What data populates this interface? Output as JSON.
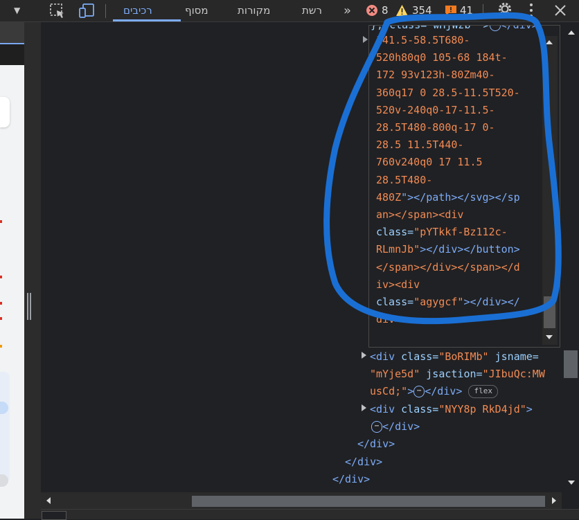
{
  "toolbar": {
    "tabs": [
      "רכיבים",
      "מסוף",
      "מקורות",
      "רשת"
    ],
    "more_tabs_icon": "double-chevron-icon",
    "errors_count": "8",
    "warnings_count": "354",
    "issues_count": "41",
    "colors": {
      "accent": "#7cacf8",
      "error": "#f28b82",
      "warning": "#fdd663",
      "issue": "#f47b20"
    }
  },
  "elements": {
    "top_line": "}, class=\"wHjWzb\" >",
    "top_line_close": "</div>",
    "edit_lines": [
      "141.5-58.5T680-",
      "520h80q0 105-68 184t-",
      "172 93v123h-80Zm40-",
      "360q17 0 28.5-11.5T520-",
      "520v-240q0-17-11.5-",
      "28.5T480-800q-17 0-",
      "28.5 11.5T440-",
      "760v240q0 17 11.5",
      "28.5T480-",
      "480Z"
    ],
    "edit_tail": {
      "l10_end": "\"></path></svg></sp",
      "l11": "an></span><div",
      "l12_attr": "class=",
      "l12_val": "\"pYTkkf-Bz112c-",
      "l13_val": "RLmnJb\"",
      "l13_tag": "></div></button>",
      "l14": "</span></div></span></d",
      "l15": "iv><div",
      "l16_attr": "class=",
      "l16_val": "\"agygcf\"",
      "l16_tag": "></div></",
      "l17": "div>"
    },
    "node1": {
      "open": "<div ",
      "attr1": "class=",
      "val1": "\"BoRIMb\"",
      "attr2": " jsname=",
      "val2": "\"mYje5d\"",
      "attr3": " jsaction=",
      "val3a": "\"JIbuQc:MW",
      "val3b": "usCd;\"",
      "close": "</div>",
      "badge": "flex"
    },
    "node2": {
      "open": "<div ",
      "attr1": "class=",
      "val1": "\"NYY8p RkD4jd\"",
      "end": ">",
      "close": "</div>"
    },
    "closing_tags": [
      "</div>",
      "</div>",
      "</div>"
    ],
    "ellipsis": "⋯"
  }
}
